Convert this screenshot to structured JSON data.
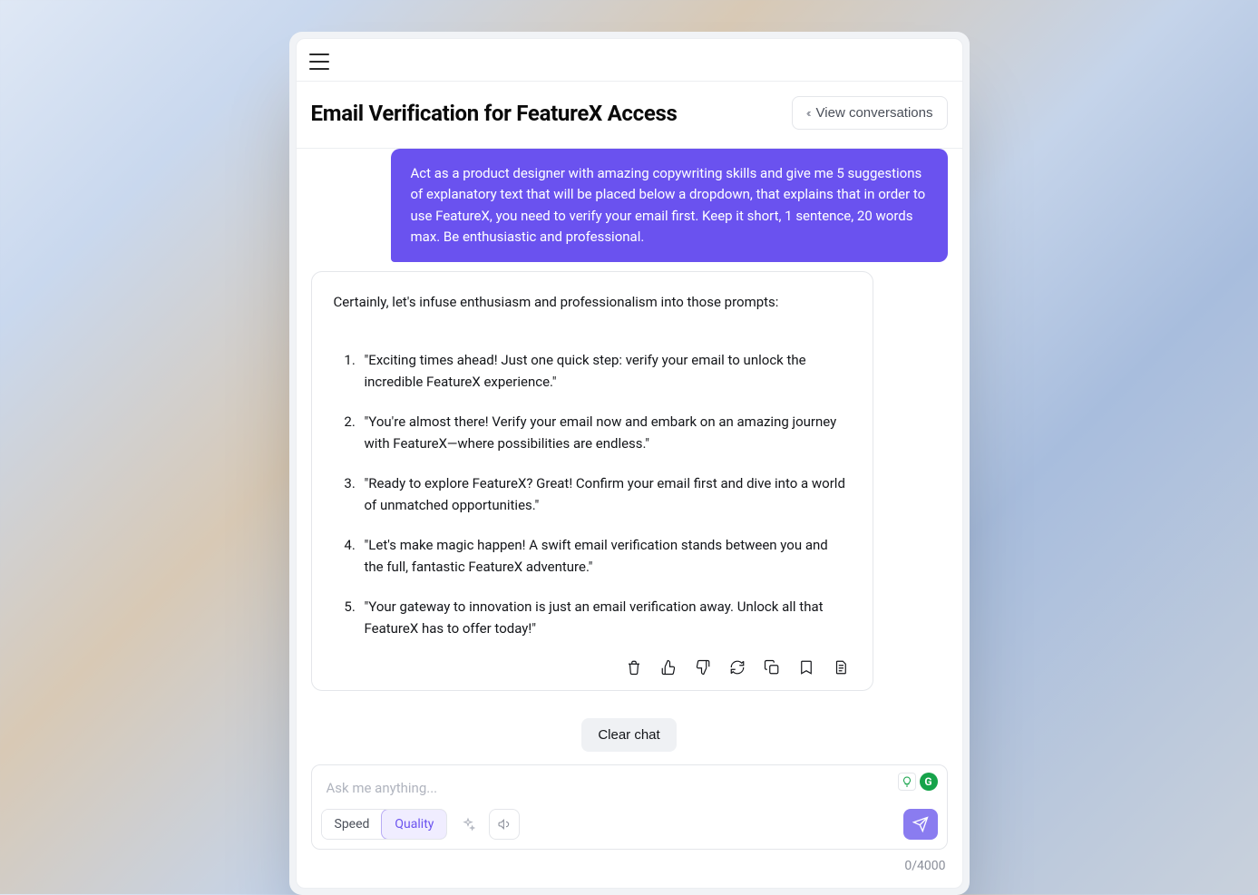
{
  "header": {
    "title": "Email Verification for FeatureX Access",
    "view_conversations": "View conversations"
  },
  "chat": {
    "user_message": "Act as a product designer with amazing copywriting skills and give me 5 suggestions of explanatory text that will be placed below a dropdown, that explains that in order to use FeatureX, you need to verify your email first. Keep it short, 1 sentence, 20 words max. Be enthusiastic and professional.",
    "assistant_intro": "Certainly, let's infuse enthusiasm and professionalism into those prompts:",
    "suggestions": [
      "\"Exciting times ahead! Just one quick step: verify your email to unlock the incredible FeatureX experience.\"",
      "\"You're almost there! Verify your email now and embark on an amazing journey with FeatureX—where possibilities are endless.\"",
      "\"Ready to explore FeatureX? Great! Confirm your email first and dive into a world of unmatched opportunities.\"",
      "\"Let's make magic happen! A swift email verification stands between you and the full, fantastic FeatureX adventure.\"",
      "\"Your gateway to innovation is just an email verification away. Unlock all that FeatureX has to offer today!\""
    ],
    "clear_label": "Clear chat"
  },
  "composer": {
    "placeholder": "Ask me anything...",
    "speed_label": "Speed",
    "quality_label": "Quality",
    "counter": "0/4000"
  },
  "badges": {
    "g": "G"
  }
}
